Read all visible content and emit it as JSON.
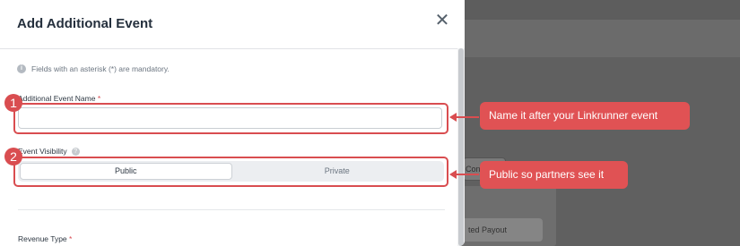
{
  "modal": {
    "title": "Add Additional Event",
    "close_icon": "close-icon",
    "notice": "Fields with an asterisk (*) are mandatory."
  },
  "fields": {
    "event_name": {
      "label": "Additional Event Name",
      "required_mark": "*",
      "value": ""
    },
    "visibility": {
      "label": "Event Visibility",
      "options": [
        "Public",
        "Private"
      ],
      "selected": "Public"
    },
    "revenue_type": {
      "label": "Revenue Type",
      "required_mark": "*"
    }
  },
  "background": {
    "button_fragment": "Conv",
    "payout_fragment": "ted Payout"
  },
  "callouts": [
    {
      "number": "1",
      "text": "Name it after your Linkrunner event"
    },
    {
      "number": "2",
      "text": "Public so partners see it"
    }
  ],
  "colors": {
    "accent": "#d94d50",
    "callout_bg": "#e05254"
  }
}
